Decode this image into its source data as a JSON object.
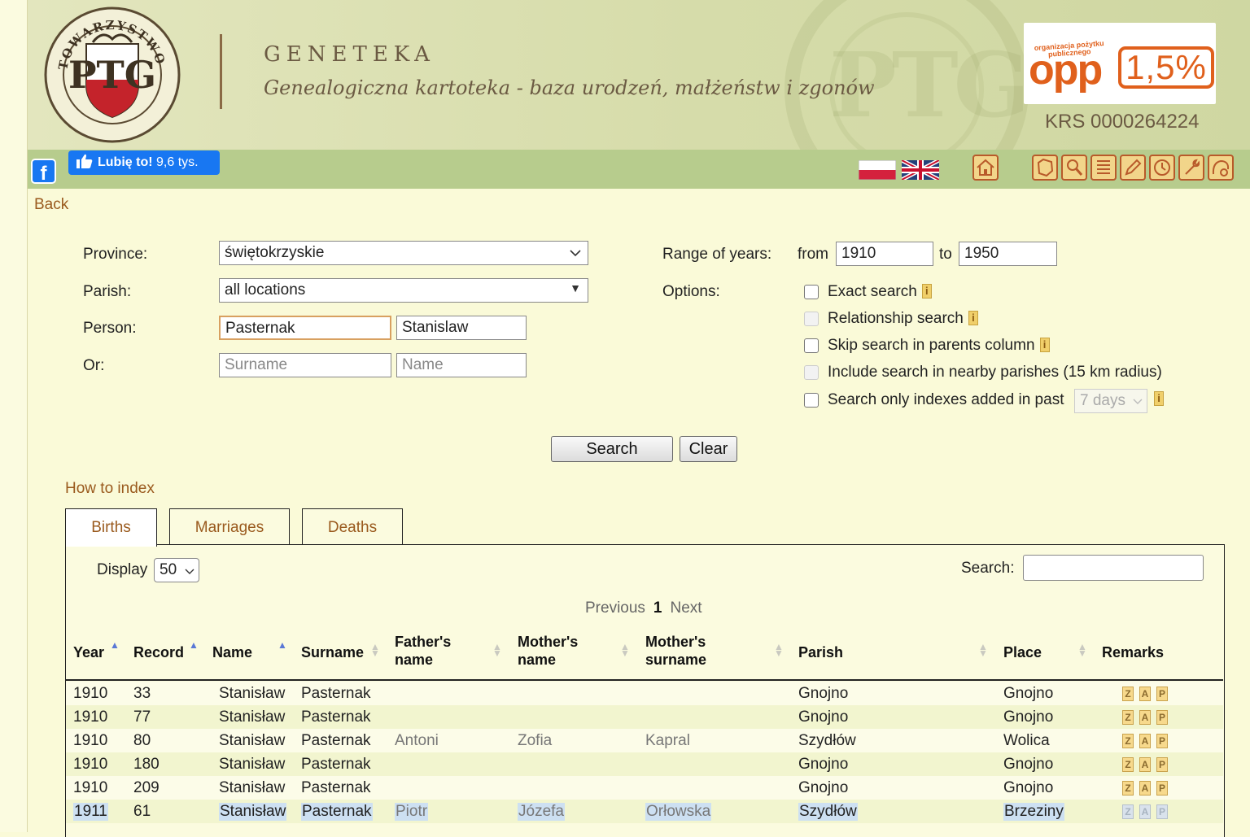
{
  "header": {
    "title": "GENETEKA",
    "subtitle": "Genealogiczna kartoteka - baza urodzeń, małżeństw i zgonów",
    "opp_small": "organizacja pożytku publicznego",
    "opp_word": "opp",
    "opp_percent": "1,5%",
    "krs": "KRS 0000264224"
  },
  "social": {
    "fb_icon": "f",
    "like_label": "Lubię to!",
    "like_count": "9,6 tys."
  },
  "back_label": "Back",
  "form": {
    "province_label": "Province:",
    "province_value": "świętokrzyskie",
    "parish_label": "Parish:",
    "parish_value": "all locations",
    "person_label": "Person:",
    "person_surname": "Pasternak",
    "person_name": "Stanislaw",
    "or_label": "Or:",
    "surname_placeholder": "Surname",
    "name_placeholder": "Name",
    "range_label": "Range of years:",
    "from_label": "from",
    "from_value": "1910",
    "to_label": "to",
    "to_value": "1950",
    "options_label": "Options:",
    "options": [
      {
        "label": "Exact search",
        "info": true,
        "disabled": false
      },
      {
        "label": "Relationship search",
        "info": true,
        "disabled": true
      },
      {
        "label": "Skip search in parents column",
        "info": true,
        "disabled": false
      },
      {
        "label": "Include search in nearby parishes (15 km radius)",
        "info": false,
        "disabled": true
      },
      {
        "label": "Search only indexes added in past",
        "info": true,
        "disabled": false
      }
    ],
    "days_value": "7 days",
    "search_button": "Search",
    "clear_button": "Clear"
  },
  "howto_label": "How to index",
  "tabs": [
    "Births",
    "Marriages",
    "Deaths"
  ],
  "table_controls": {
    "display_label": "Display",
    "display_value": "50",
    "search_label": "Search:",
    "prev_label": "Previous",
    "page": "1",
    "next_label": "Next"
  },
  "columns": [
    {
      "line1": "Year",
      "line2": ""
    },
    {
      "line1": "Record",
      "line2": ""
    },
    {
      "line1": "Name",
      "line2": ""
    },
    {
      "line1": "Surname",
      "line2": ""
    },
    {
      "line1": "Father's",
      "line2": "name"
    },
    {
      "line1": "Mother's",
      "line2": "name"
    },
    {
      "line1": "Mother's",
      "line2": "surname"
    },
    {
      "line1": "Parish",
      "line2": ""
    },
    {
      "line1": "Place",
      "line2": ""
    },
    {
      "line1": "Remarks",
      "line2": ""
    }
  ],
  "remarks_icons": [
    "Z",
    "A",
    "P"
  ],
  "rows": [
    {
      "year": "1910",
      "record": "33",
      "name": "Stanisław",
      "surname": "Pasternak",
      "father": "",
      "mother": "",
      "mother_surname": "",
      "parish": "Gnojno",
      "place": "Gnojno"
    },
    {
      "year": "1910",
      "record": "77",
      "name": "Stanisław",
      "surname": "Pasternak",
      "father": "",
      "mother": "",
      "mother_surname": "",
      "parish": "Gnojno",
      "place": "Gnojno"
    },
    {
      "year": "1910",
      "record": "80",
      "name": "Stanisław",
      "surname": "Pasternak",
      "father": "Antoni",
      "mother": "Zofia",
      "mother_surname": "Kapral",
      "parish": "Szydłów",
      "place": "Wolica"
    },
    {
      "year": "1910",
      "record": "180",
      "name": "Stanisław",
      "surname": "Pasternak",
      "father": "",
      "mother": "",
      "mother_surname": "",
      "parish": "Gnojno",
      "place": "Gnojno"
    },
    {
      "year": "1910",
      "record": "209",
      "name": "Stanisław",
      "surname": "Pasternak",
      "father": "",
      "mother": "",
      "mother_surname": "",
      "parish": "Gnojno",
      "place": "Gnojno"
    },
    {
      "year": "1911",
      "record": "61",
      "name": "Stanisław",
      "surname": "Pasternak",
      "father": "Piotr",
      "mother": "Józefa",
      "mother_surname": "Orłowska",
      "parish": "Szydłów",
      "place": "Brzeziny"
    }
  ]
}
